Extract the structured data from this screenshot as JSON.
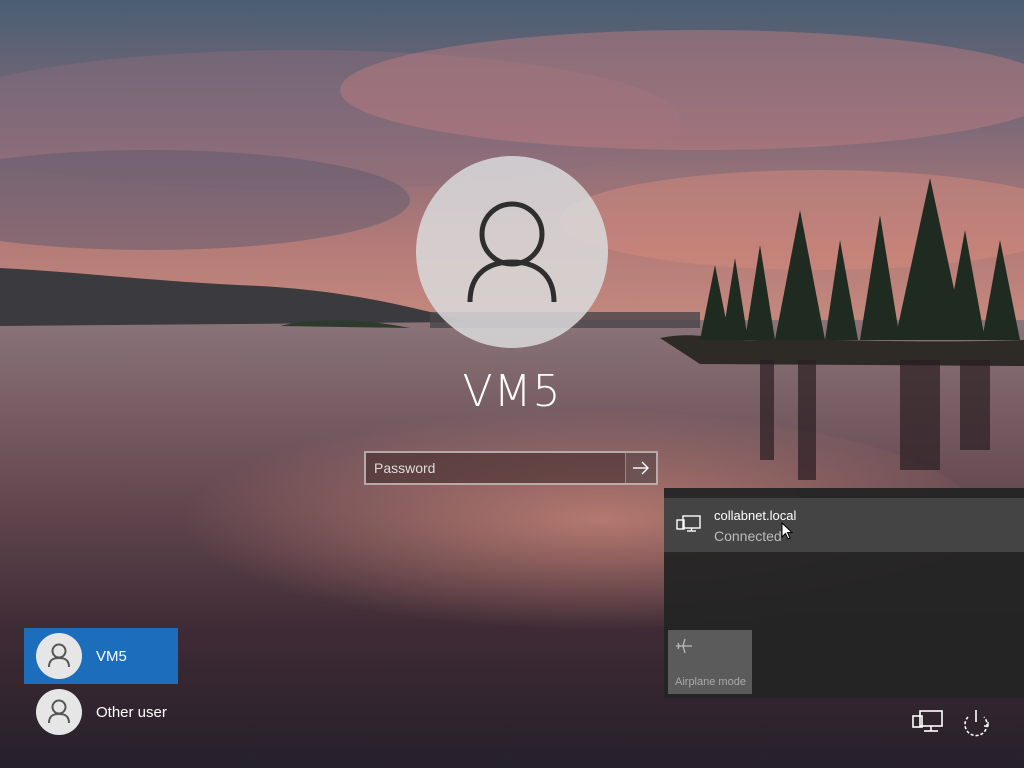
{
  "user": {
    "name": "VM5"
  },
  "password": {
    "placeholder": "Password"
  },
  "users": [
    {
      "label": "VM5",
      "selected": true
    },
    {
      "label": "Other user",
      "selected": false
    }
  ],
  "network": {
    "name": "collabnet.local",
    "status": "Connected",
    "tile_label": "Airplane mode"
  },
  "icons": {
    "avatar": "user-avatar-icon",
    "submit": "arrow-right-icon",
    "network": "ethernet-network-icon",
    "airplane": "airplane-icon",
    "power": "power-icon"
  },
  "colors": {
    "selected_user": "#1c6dbb",
    "flyout_bg": "#242424"
  }
}
